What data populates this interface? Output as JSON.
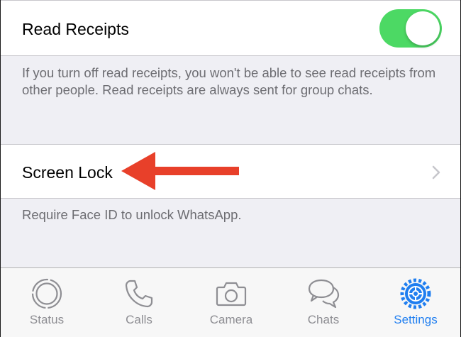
{
  "read_receipts": {
    "label": "Read Receipts",
    "toggle_on": true,
    "toggle_color": "#4cd964",
    "note": "If you turn off read receipts, you won't be able to see read receipts from other people. Read receipts are always sent for group chats."
  },
  "screen_lock": {
    "label": "Screen Lock",
    "chevron_icon": "chevron-right-icon",
    "note": "Require Face ID to unlock WhatsApp."
  },
  "annotation": {
    "arrow_icon": "red-arrow-left-icon",
    "color": "#e8402a"
  },
  "tabbar": {
    "active_color": "#1f7ef0",
    "inactive_color": "#8e8e93",
    "tabs": [
      {
        "label": "Status",
        "icon": "status-icon",
        "active": false
      },
      {
        "label": "Calls",
        "icon": "phone-icon",
        "active": false
      },
      {
        "label": "Camera",
        "icon": "camera-icon",
        "active": false
      },
      {
        "label": "Chats",
        "icon": "chat-bubbles-icon",
        "active": false
      },
      {
        "label": "Settings",
        "icon": "gear-icon",
        "active": true
      }
    ]
  }
}
